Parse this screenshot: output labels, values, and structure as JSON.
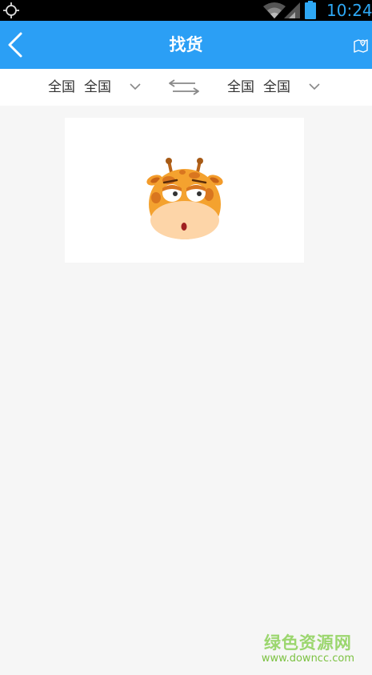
{
  "status_bar": {
    "time": "10:24",
    "icons": [
      "gps-icon",
      "wifi-icon",
      "signal-icon",
      "battery-icon"
    ]
  },
  "header": {
    "title": "找货",
    "back_icon": "back-chevron-icon",
    "map_icon": "map-pin-icon",
    "background_color": "#2b9ff5"
  },
  "route_filter": {
    "origin": {
      "province": "全国",
      "city": "全国"
    },
    "destination": {
      "province": "全国",
      "city": "全国"
    },
    "swap_icon": "swap-arrows-icon"
  },
  "content": {
    "empty_illustration": "giraffe-face"
  },
  "watermark": {
    "name": "绿色资源网",
    "url": "www.downcc.com"
  }
}
